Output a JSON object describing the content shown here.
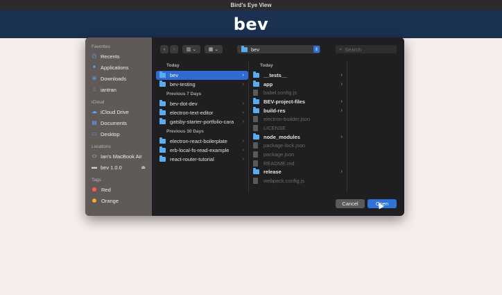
{
  "window": {
    "title": "Bird's Eye View"
  },
  "app": {
    "logo": "bev"
  },
  "sidebar": {
    "favorites_label": "Favorites",
    "favorites": [
      {
        "label": "Recents",
        "icon": "clock-icon"
      },
      {
        "label": "Applications",
        "icon": "applications-icon"
      },
      {
        "label": "Downloads",
        "icon": "downloads-icon"
      },
      {
        "label": "iantran",
        "icon": "home-icon"
      }
    ],
    "icloud_label": "iCloud",
    "icloud": [
      {
        "label": "iCloud Drive",
        "icon": "cloud-icon"
      },
      {
        "label": "Documents",
        "icon": "document-icon"
      },
      {
        "label": "Desktop",
        "icon": "desktop-icon"
      }
    ],
    "locations_label": "Locations",
    "locations": [
      {
        "label": "Ian's MacBook Air",
        "icon": "laptop-icon"
      },
      {
        "label": "bev 1.0.0",
        "icon": "drive-icon"
      }
    ],
    "tags_label": "Tags",
    "tags": [
      {
        "label": "Red",
        "color": "#ff5a52"
      },
      {
        "label": "Orange",
        "color": "#ffa531"
      }
    ]
  },
  "toolbar": {
    "path": "bev",
    "search_placeholder": "Search"
  },
  "column1": {
    "today_label": "Today",
    "today": [
      {
        "label": "bev"
      },
      {
        "label": "bev-testing"
      }
    ],
    "prev7_label": "Previous 7 Days",
    "prev7": [
      {
        "label": "bev-dot-dev"
      },
      {
        "label": "electron-text-editor"
      },
      {
        "label": "gatsby-starter-portfolio-cara"
      }
    ],
    "prev30_label": "Previous 30 Days",
    "prev30": [
      {
        "label": "electron-react-boilerplate"
      },
      {
        "label": "erb-local-fs-read-example"
      },
      {
        "label": "react-router-tutorial"
      }
    ]
  },
  "column2": {
    "today_label": "Today",
    "items": [
      {
        "label": "__tests__"
      },
      {
        "label": "app"
      },
      {
        "label": "babel.config.js"
      },
      {
        "label": "BEV-project-files"
      },
      {
        "label": "build-res"
      },
      {
        "label": "electron-builder.json"
      },
      {
        "label": "LICENSE"
      },
      {
        "label": "node_modules"
      },
      {
        "label": "package-lock.json"
      },
      {
        "label": "package.json"
      },
      {
        "label": "README.md"
      },
      {
        "label": "release"
      },
      {
        "label": "webpack.config.js"
      }
    ]
  },
  "buttons": {
    "cancel": "Cancel",
    "open": "Open"
  }
}
